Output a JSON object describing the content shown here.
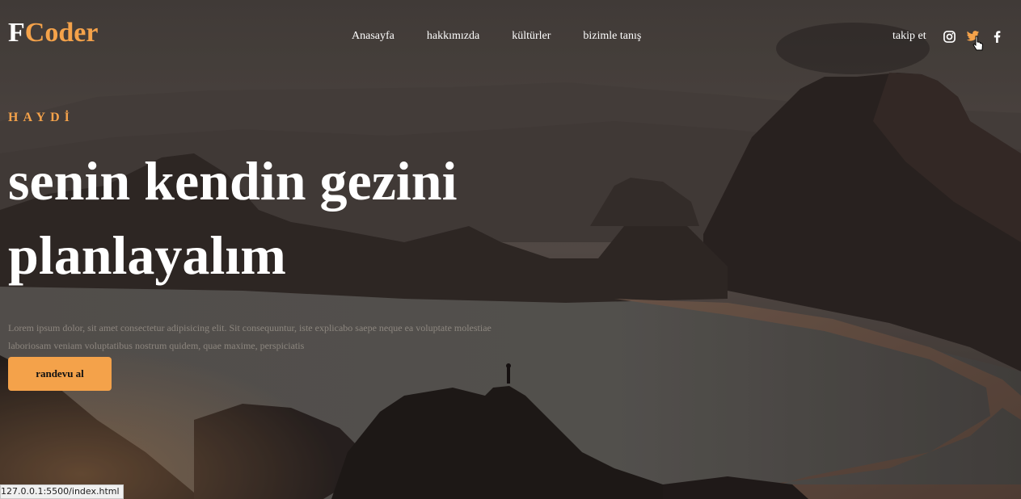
{
  "brand": {
    "part1": "F",
    "part2": "Coder"
  },
  "nav": {
    "items": [
      {
        "label": "Anasayfa"
      },
      {
        "label": "hakkımızda"
      },
      {
        "label": "kültürler"
      },
      {
        "label": "bizimle tanış"
      }
    ],
    "follow_label": "takip et",
    "social_icons": [
      "instagram-icon",
      "twitter-icon",
      "facebook-icon"
    ]
  },
  "hero": {
    "eyebrow": "HAYDİ",
    "headline": "senin kendin gezini planlayalım",
    "paragraph": "Lorem ipsum dolor, sit amet consectetur adipisicing elit. Sit consequuntur, iste explicabo saepe neque ea voluptate molestiae laboriosam veniam voluptatibus nostrum quidem, quae maxime, perspiciatis",
    "cta_label": "randevu al"
  },
  "status_bar": {
    "url": "127.0.0.1:5500/index.html"
  },
  "colors": {
    "accent": "#f4a24a",
    "text": "#ffffff",
    "hovered_icon": "#f4a24a"
  }
}
